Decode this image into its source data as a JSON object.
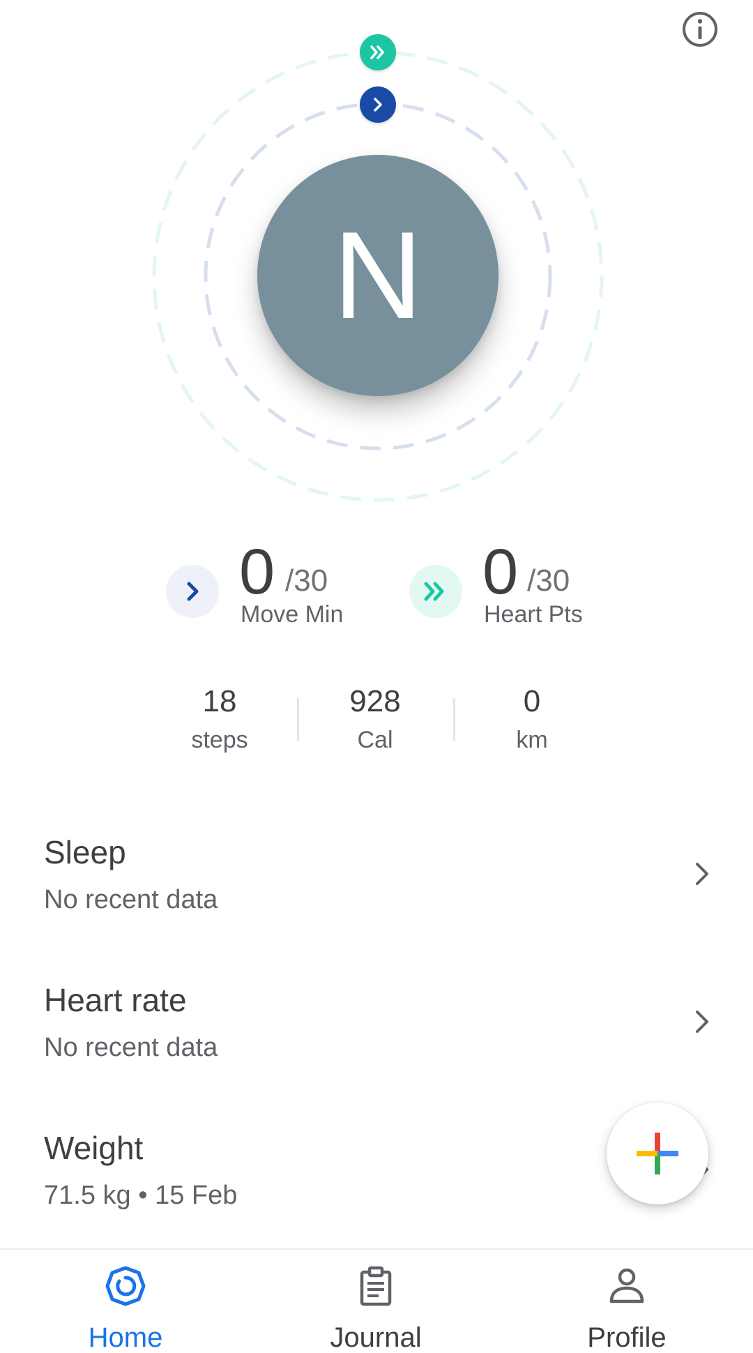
{
  "profile": {
    "initial": "N"
  },
  "goals": {
    "move": {
      "value": "0",
      "target": "/30",
      "label": "Move Min",
      "color": "#1a4aa6"
    },
    "heart": {
      "value": "0",
      "target": "/30",
      "label": "Heart Pts",
      "color": "#1cc6a2"
    }
  },
  "metrics": [
    {
      "value": "18",
      "unit": "steps"
    },
    {
      "value": "928",
      "unit": "Cal"
    },
    {
      "value": "0",
      "unit": "km"
    }
  ],
  "cards": [
    {
      "title": "Sleep",
      "subtitle": "No recent data"
    },
    {
      "title": "Heart rate",
      "subtitle": "No recent data"
    },
    {
      "title": "Weight",
      "subtitle": "71.5 kg • 15 Feb"
    }
  ],
  "nav": {
    "items": [
      {
        "label": "Home",
        "icon": "home-ring-icon",
        "active": true
      },
      {
        "label": "Journal",
        "icon": "clipboard-icon",
        "active": false
      },
      {
        "label": "Profile",
        "icon": "person-icon",
        "active": false
      }
    ],
    "active_color": "#1a73e8"
  },
  "icons": {
    "info": "info-icon",
    "add": "add-plus-icon"
  }
}
